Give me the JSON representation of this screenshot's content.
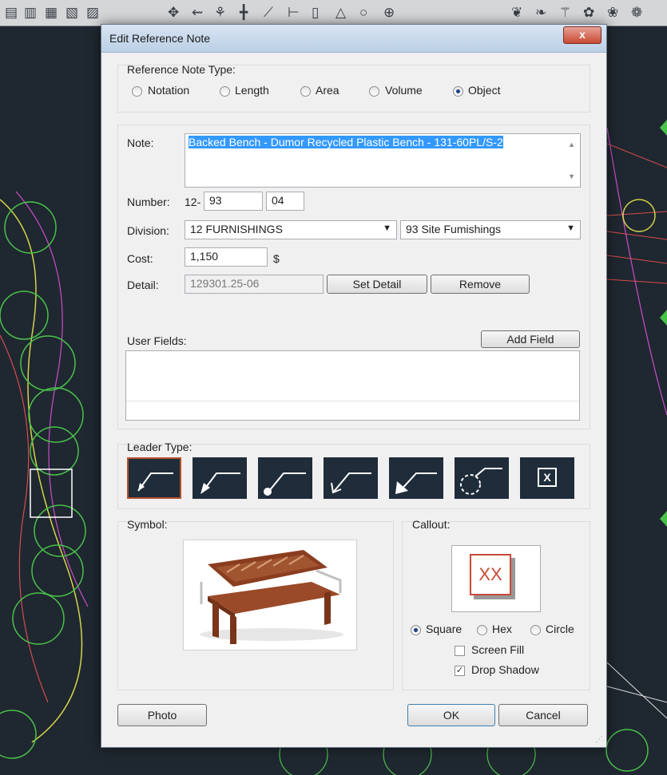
{
  "dialog": {
    "title": "Edit Reference Note",
    "close_label": "x"
  },
  "ref_type": {
    "label": "Reference Note Type:",
    "options": [
      "Notation",
      "Length",
      "Area",
      "Volume",
      "Object"
    ],
    "selected": "Object"
  },
  "note": {
    "label": "Note:",
    "value": "Backed Bench - Dumor Recycled Plastic Bench - 131-60PL/S-2"
  },
  "number": {
    "label": "Number:",
    "prefix": "12-",
    "part1": "93",
    "part2": "04"
  },
  "division": {
    "label": "Division:",
    "value": "12 FURNISHINGS",
    "subdivision": "93 Site Fumishings"
  },
  "cost": {
    "label": "Cost:",
    "value": "1,150",
    "unit": "$"
  },
  "detail": {
    "label": "Detail:",
    "value": "129301.25-06",
    "set_label": "Set Detail",
    "remove_label": "Remove"
  },
  "user_fields": {
    "label": "User Fields:",
    "add_label": "Add Field"
  },
  "leader_type": {
    "label": "Leader Type:",
    "selected_index": 0,
    "box_label": "X"
  },
  "symbol": {
    "label": "Symbol:"
  },
  "callout": {
    "label": "Callout:",
    "preview_text": "XX",
    "shapes": [
      "Square",
      "Hex",
      "Circle"
    ],
    "selected_shape": "Square",
    "screen_fill_label": "Screen Fill",
    "screen_fill": false,
    "drop_shadow_label": "Drop Shadow",
    "drop_shadow": true
  },
  "footer": {
    "photo_label": "Photo",
    "ok_label": "OK",
    "cancel_label": "Cancel"
  },
  "colors": {
    "cad_background": "#1f2730",
    "selection": "#3399ff",
    "leader_tile": "#1f2c3a",
    "leader_selected_border": "#b5502f",
    "callout_accent": "#c84a35"
  }
}
